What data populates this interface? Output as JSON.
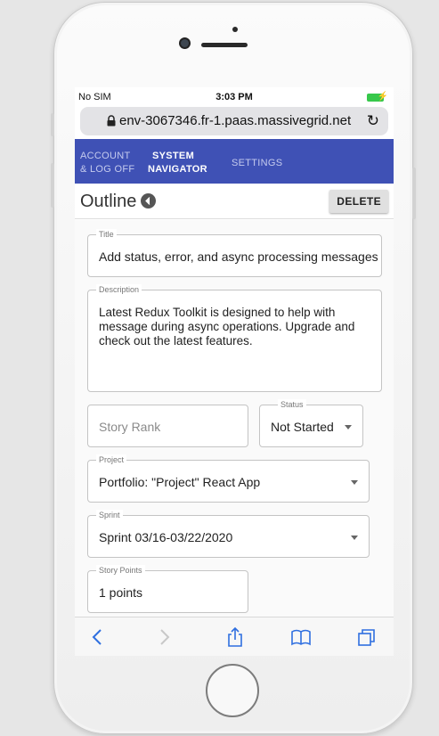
{
  "status_bar": {
    "carrier": "No SIM",
    "time": "3:03 PM"
  },
  "browser": {
    "url": "env-3067346.fr-1.paas.massivegrid.net"
  },
  "nav": {
    "items": [
      {
        "line1": "ACCOUNT",
        "line2": "& LOG OFF",
        "active": false
      },
      {
        "line1": "SYSTEM",
        "line2": "NAVIGATOR",
        "active": true
      },
      {
        "line1": "SETTINGS",
        "line2": "",
        "active": false
      }
    ],
    "accent_color": "#3f51b5"
  },
  "page": {
    "title": "Outline",
    "delete_label": "DELETE"
  },
  "form": {
    "title": {
      "label": "Title",
      "value": "Add status, error, and async processing messages"
    },
    "description": {
      "label": "Description",
      "value": "Latest Redux Toolkit is designed to help with message during async operations.  Upgrade and check out the latest features."
    },
    "story_rank": {
      "placeholder": "Story Rank"
    },
    "status": {
      "label": "Status",
      "value": "Not Started"
    },
    "project": {
      "label": "Project",
      "value": "Portfolio: \"Project\" React App"
    },
    "sprint": {
      "label": "Sprint",
      "value": "Sprint 03/16-03/22/2020"
    },
    "story_points": {
      "label": "Story Points",
      "value": "1 points"
    }
  },
  "toolbar": {
    "icons": [
      "back-icon",
      "forward-icon",
      "share-icon",
      "bookmarks-icon",
      "tabs-icon"
    ]
  }
}
